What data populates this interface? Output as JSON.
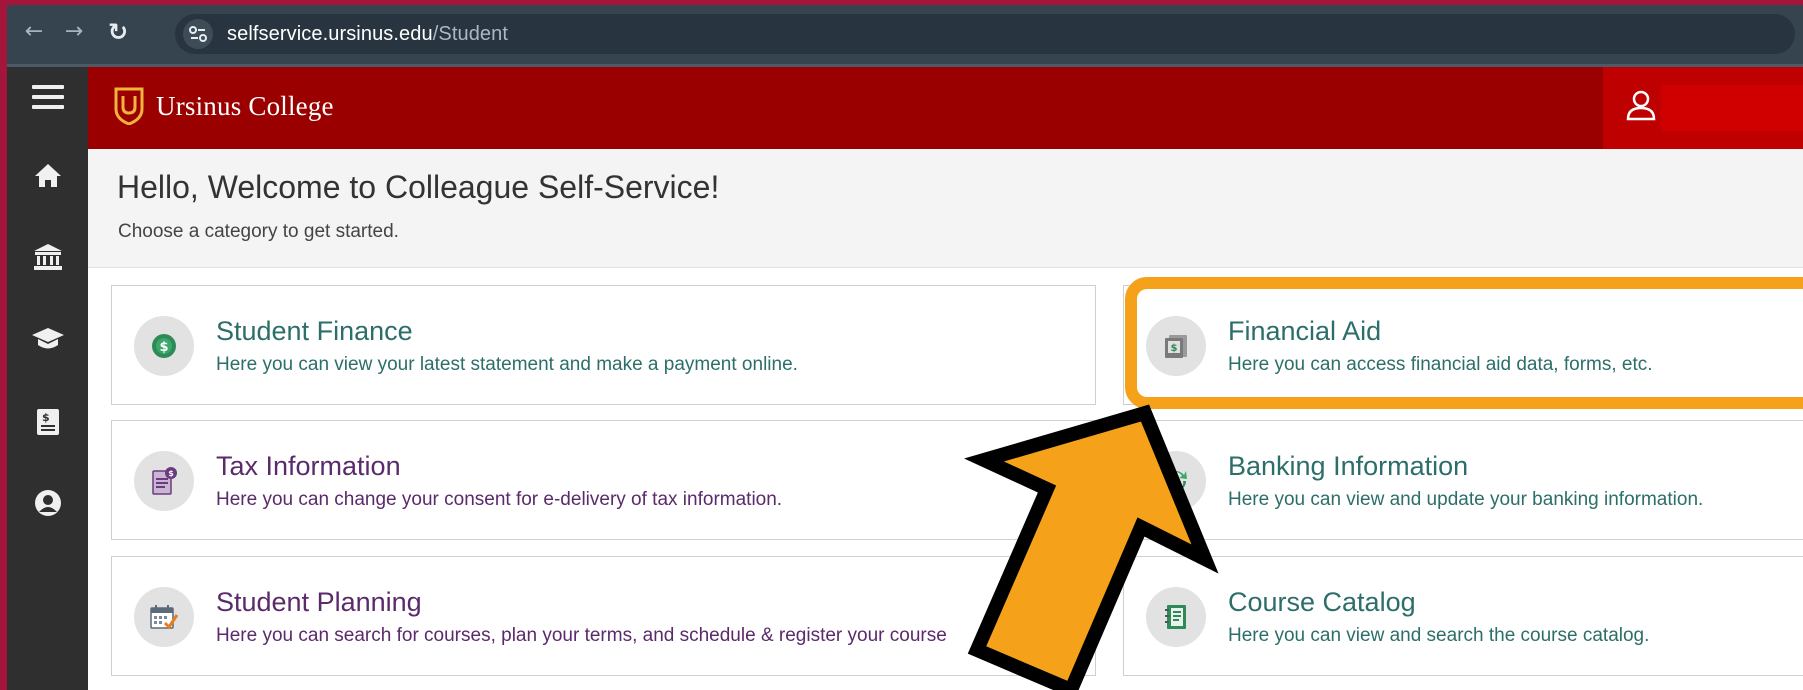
{
  "browser": {
    "url_domain": "selfservice.ursinus.edu",
    "url_path": "/Student",
    "back_icon": "arrow-left-icon",
    "forward_icon": "arrow-right-icon",
    "reload_icon": "reload-icon",
    "site_info_icon": "tune-icon"
  },
  "sidebar": {
    "items": [
      {
        "icon": "menu-icon"
      },
      {
        "icon": "home-icon"
      },
      {
        "icon": "bank-icon"
      },
      {
        "icon": "graduation-cap-icon"
      },
      {
        "icon": "receipt-icon"
      },
      {
        "icon": "user-circle-icon"
      }
    ]
  },
  "header": {
    "brand_name": "Ursinus College",
    "logo_letter": "U",
    "user_icon": "user-icon"
  },
  "welcome": {
    "title": "Hello, Welcome to Colleague Self-Service!",
    "subtitle": "Choose a category to get started."
  },
  "cards": [
    {
      "title": "Student Finance",
      "description": "Here you can view your latest statement and make a payment online.",
      "icon": "dollar-coin-icon"
    },
    {
      "title": "Financial Aid",
      "description": "Here you can access financial aid data, forms, etc.",
      "icon": "money-document-icon"
    },
    {
      "title": "Tax Information",
      "description": "Here you can change your consent for e-delivery of tax information.",
      "icon": "tax-document-icon"
    },
    {
      "title": "Banking Information",
      "description": "Here you can view and update your banking information.",
      "icon": "bank-transfer-icon"
    },
    {
      "title": "Student Planning",
      "description": "Here you can search for courses, plan your terms, and schedule & register your course",
      "icon": "calendar-check-icon"
    },
    {
      "title": "Course Catalog",
      "description": "Here you can view and search the course catalog.",
      "icon": "catalog-book-icon"
    }
  ],
  "colors": {
    "header_red": "#9a0000",
    "card_text_teal": "#2c6e6a",
    "card_text_purple": "#5a2a6b",
    "highlight_orange": "#f6a11a",
    "sidebar_dark": "#2f2f2f"
  }
}
